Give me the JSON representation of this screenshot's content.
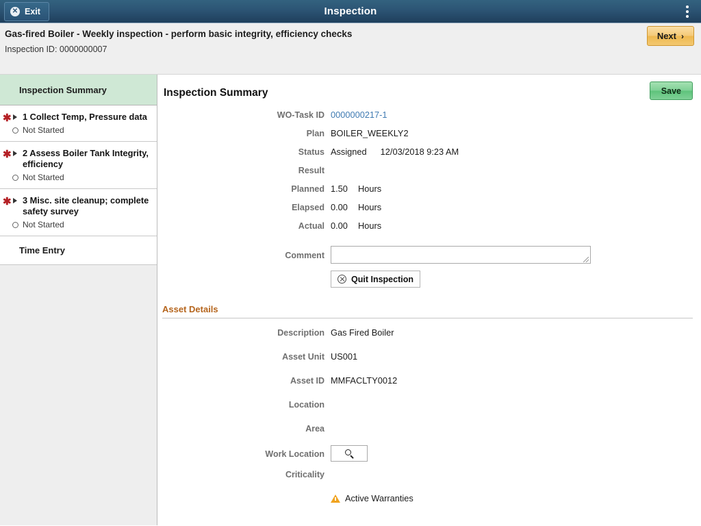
{
  "titlebar": {
    "exit_label": "Exit",
    "title": "Inspection",
    "menu_icon": "kebab-menu-icon"
  },
  "subheader": {
    "title": "Gas-fired Boiler - Weekly inspection - perform basic integrity, efficiency checks",
    "subtitle": "Inspection ID: 0000000007",
    "next_label": "Next",
    "next_chevron": "›"
  },
  "sidebar": {
    "active_tab": "Inspection Summary",
    "items": [
      {
        "required_marker": "✱",
        "title": "1 Collect Temp, Pressure data",
        "status": "Not Started"
      },
      {
        "required_marker": "✱",
        "title": "2 Assess Boiler Tank Integrity, efficiency",
        "status": "Not Started"
      },
      {
        "required_marker": "✱",
        "title": "3 Misc. site cleanup; complete safety survey",
        "status": "Not Started"
      }
    ],
    "time_entry_label": "Time Entry"
  },
  "main": {
    "title": "Inspection Summary",
    "save_label": "Save",
    "fields": {
      "wo_task_id_label": "WO-Task ID",
      "wo_task_id_value": "0000000217-1",
      "plan_label": "Plan",
      "plan_value": "BOILER_WEEKLY2",
      "status_label": "Status",
      "status_value": "Assigned",
      "status_timestamp": "12/03/2018 9:23 AM",
      "result_label": "Result",
      "result_value": "",
      "planned_label": "Planned",
      "planned_value": "1.50",
      "planned_unit": "Hours",
      "elapsed_label": "Elapsed",
      "elapsed_value": "0.00",
      "elapsed_unit": "Hours",
      "actual_label": "Actual",
      "actual_value": "0.00",
      "actual_unit": "Hours",
      "comment_label": "Comment",
      "comment_value": "",
      "comment_placeholder": ""
    },
    "quit_label": "Quit Inspection"
  },
  "asset_details": {
    "section_title": "Asset Details",
    "description_label": "Description",
    "description_value": "Gas Fired Boiler",
    "asset_unit_label": "Asset Unit",
    "asset_unit_value": "US001",
    "asset_id_label": "Asset ID",
    "asset_id_value": "MMFACLTY0012",
    "location_label": "Location",
    "location_value": "",
    "area_label": "Area",
    "area_value": "",
    "work_location_label": "Work Location",
    "work_location_value": "",
    "criticality_label": "Criticality",
    "criticality_value": "",
    "warranties_label": "Active Warranties"
  },
  "colors": {
    "titlebar": "#2c5474",
    "active_tab": "#cfe8d5",
    "save_green": "#7ed195",
    "next_gold": "#f4c977",
    "link_blue": "#3f7ab2",
    "section_orange": "#b5651d",
    "required_red": "#b41f24",
    "warning_orange": "#f0a31e"
  }
}
